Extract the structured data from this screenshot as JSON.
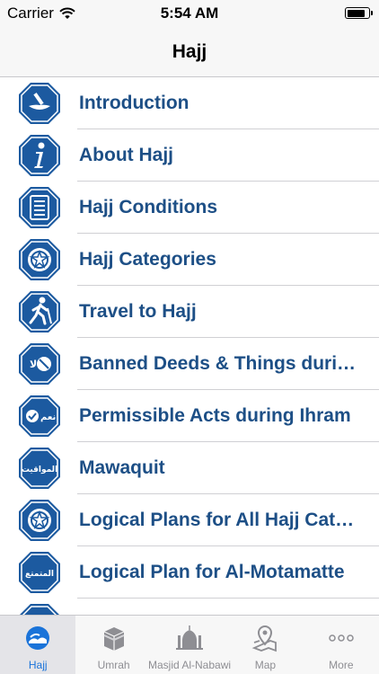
{
  "status": {
    "carrier": "Carrier",
    "time": "5:54 AM",
    "battery_level": 0.9
  },
  "nav": {
    "title": "Hajj"
  },
  "list": {
    "items": [
      {
        "label": "Introduction",
        "icon": "introduction-icon"
      },
      {
        "label": "About Hajj",
        "icon": "info-icon"
      },
      {
        "label": "Hajj Conditions",
        "icon": "list-icon"
      },
      {
        "label": "Hajj Categories",
        "icon": "categories-icon"
      },
      {
        "label": "Travel to Hajj",
        "icon": "traveler-icon"
      },
      {
        "label": "Banned Deeds & Things during Ihram",
        "icon": "banned-icon",
        "badge": "لا"
      },
      {
        "label": "Permissible Acts during Ihram",
        "icon": "permissible-icon",
        "badge": "نعم"
      },
      {
        "label": "Mawaquit",
        "icon": "mawaquit-icon",
        "badge": "المواقيت"
      },
      {
        "label": "Logical Plans for All Hajj Categories",
        "icon": "plans-icon"
      },
      {
        "label": "Logical Plan for Al-Motamatte",
        "icon": "motamatte-icon",
        "badge": "المتمتع"
      }
    ]
  },
  "tabs": [
    {
      "label": "Hajj",
      "icon": "hajj-tab-icon",
      "active": true
    },
    {
      "label": "Umrah",
      "icon": "kaaba-icon",
      "active": false
    },
    {
      "label": "Masjid Al-Nabawi",
      "icon": "mosque-icon",
      "active": false
    },
    {
      "label": "Map",
      "icon": "map-icon",
      "active": false
    },
    {
      "label": "More",
      "icon": "more-icon",
      "active": false
    }
  ],
  "colors": {
    "icon_blue": "#1c5aa0",
    "label_blue": "#1d4f86",
    "tab_active": "#1a73d9",
    "tab_inactive": "#8e8e93"
  }
}
